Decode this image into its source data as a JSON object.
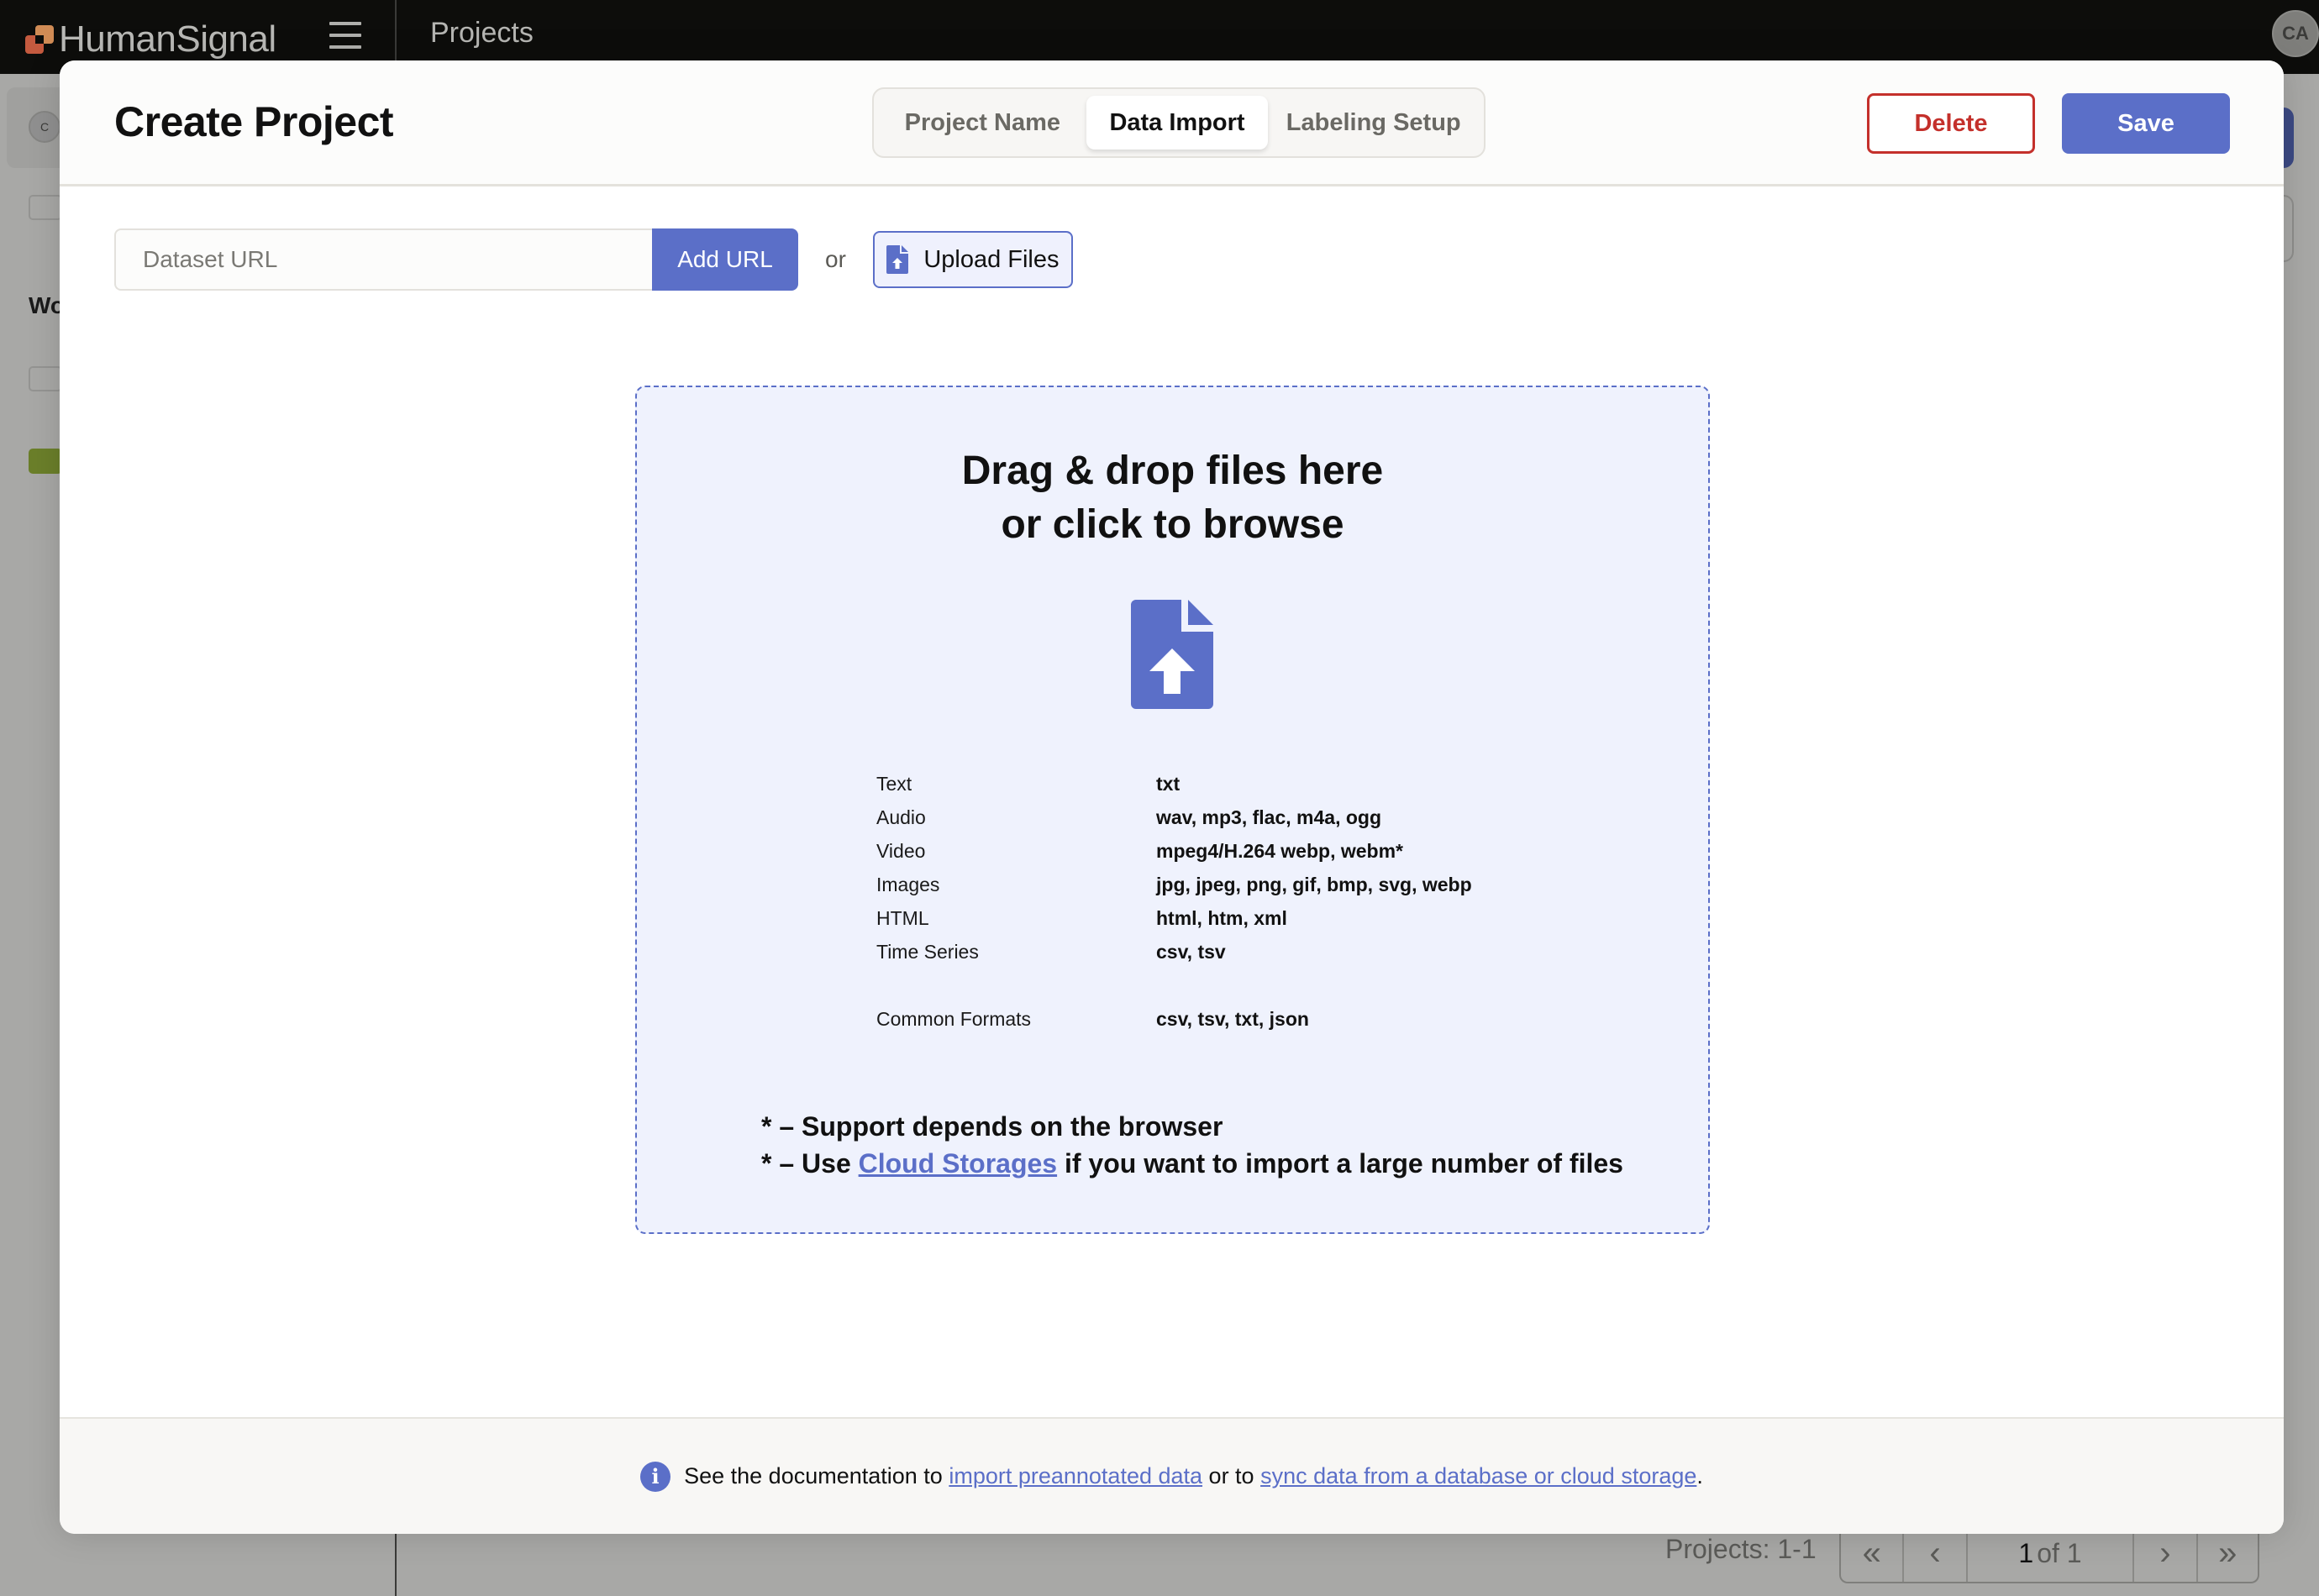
{
  "topbar": {
    "brand": "HumanSignal",
    "page_title": "Projects",
    "user_initials": "CA"
  },
  "background": {
    "sidebar_avatar": "C",
    "sidebar_section_label_partial": "Wo",
    "pagination": {
      "label": "Projects: 1-1",
      "current_page": "1",
      "of_text": "of 1",
      "first_icon": "«",
      "prev_icon": "‹",
      "next_icon": "›",
      "last_icon": "»"
    }
  },
  "modal": {
    "title": "Create Project",
    "tabs": [
      {
        "label": "Project Name",
        "active": false
      },
      {
        "label": "Data Import",
        "active": true
      },
      {
        "label": "Labeling Setup",
        "active": false
      }
    ],
    "delete_label": "Delete",
    "save_label": "Save",
    "url_input": {
      "placeholder": "Dataset URL",
      "value": ""
    },
    "add_url_label": "Add URL",
    "or_text": "or",
    "upload_label": "Upload Files",
    "dropzone": {
      "title_line1": "Drag & drop files here",
      "title_line2": "or click to browse",
      "formats": [
        {
          "type": "Text",
          "extensions": "txt"
        },
        {
          "type": "Audio",
          "extensions": "wav, mp3, flac, m4a, ogg"
        },
        {
          "type": "Video",
          "extensions": "mpeg4/H.264 webp, webm*"
        },
        {
          "type": "Images",
          "extensions": "jpg, jpeg, png, gif, bmp, svg, webp"
        },
        {
          "type": "HTML",
          "extensions": "html, htm, xml"
        },
        {
          "type": "Time Series",
          "extensions": "csv, tsv"
        },
        {
          "type": "Common Formats",
          "extensions": "csv, tsv, txt, json"
        }
      ],
      "note1": "* – Support depends on the browser",
      "note2_prefix": "* – Use ",
      "note2_link": "Cloud Storages",
      "note2_suffix": " if you want to import a large number of files"
    },
    "footer": {
      "info_icon": "i",
      "text1": "See the documentation to ",
      "link1": "import preannotated data",
      "text2": " or to ",
      "link2": "sync data from a database or cloud storage",
      "text3": "."
    }
  },
  "colors": {
    "accent": "#5b6fc8",
    "danger": "#c4302b",
    "topbar": "#0d0d0b",
    "dropzone_bg": "#eff2fd"
  }
}
